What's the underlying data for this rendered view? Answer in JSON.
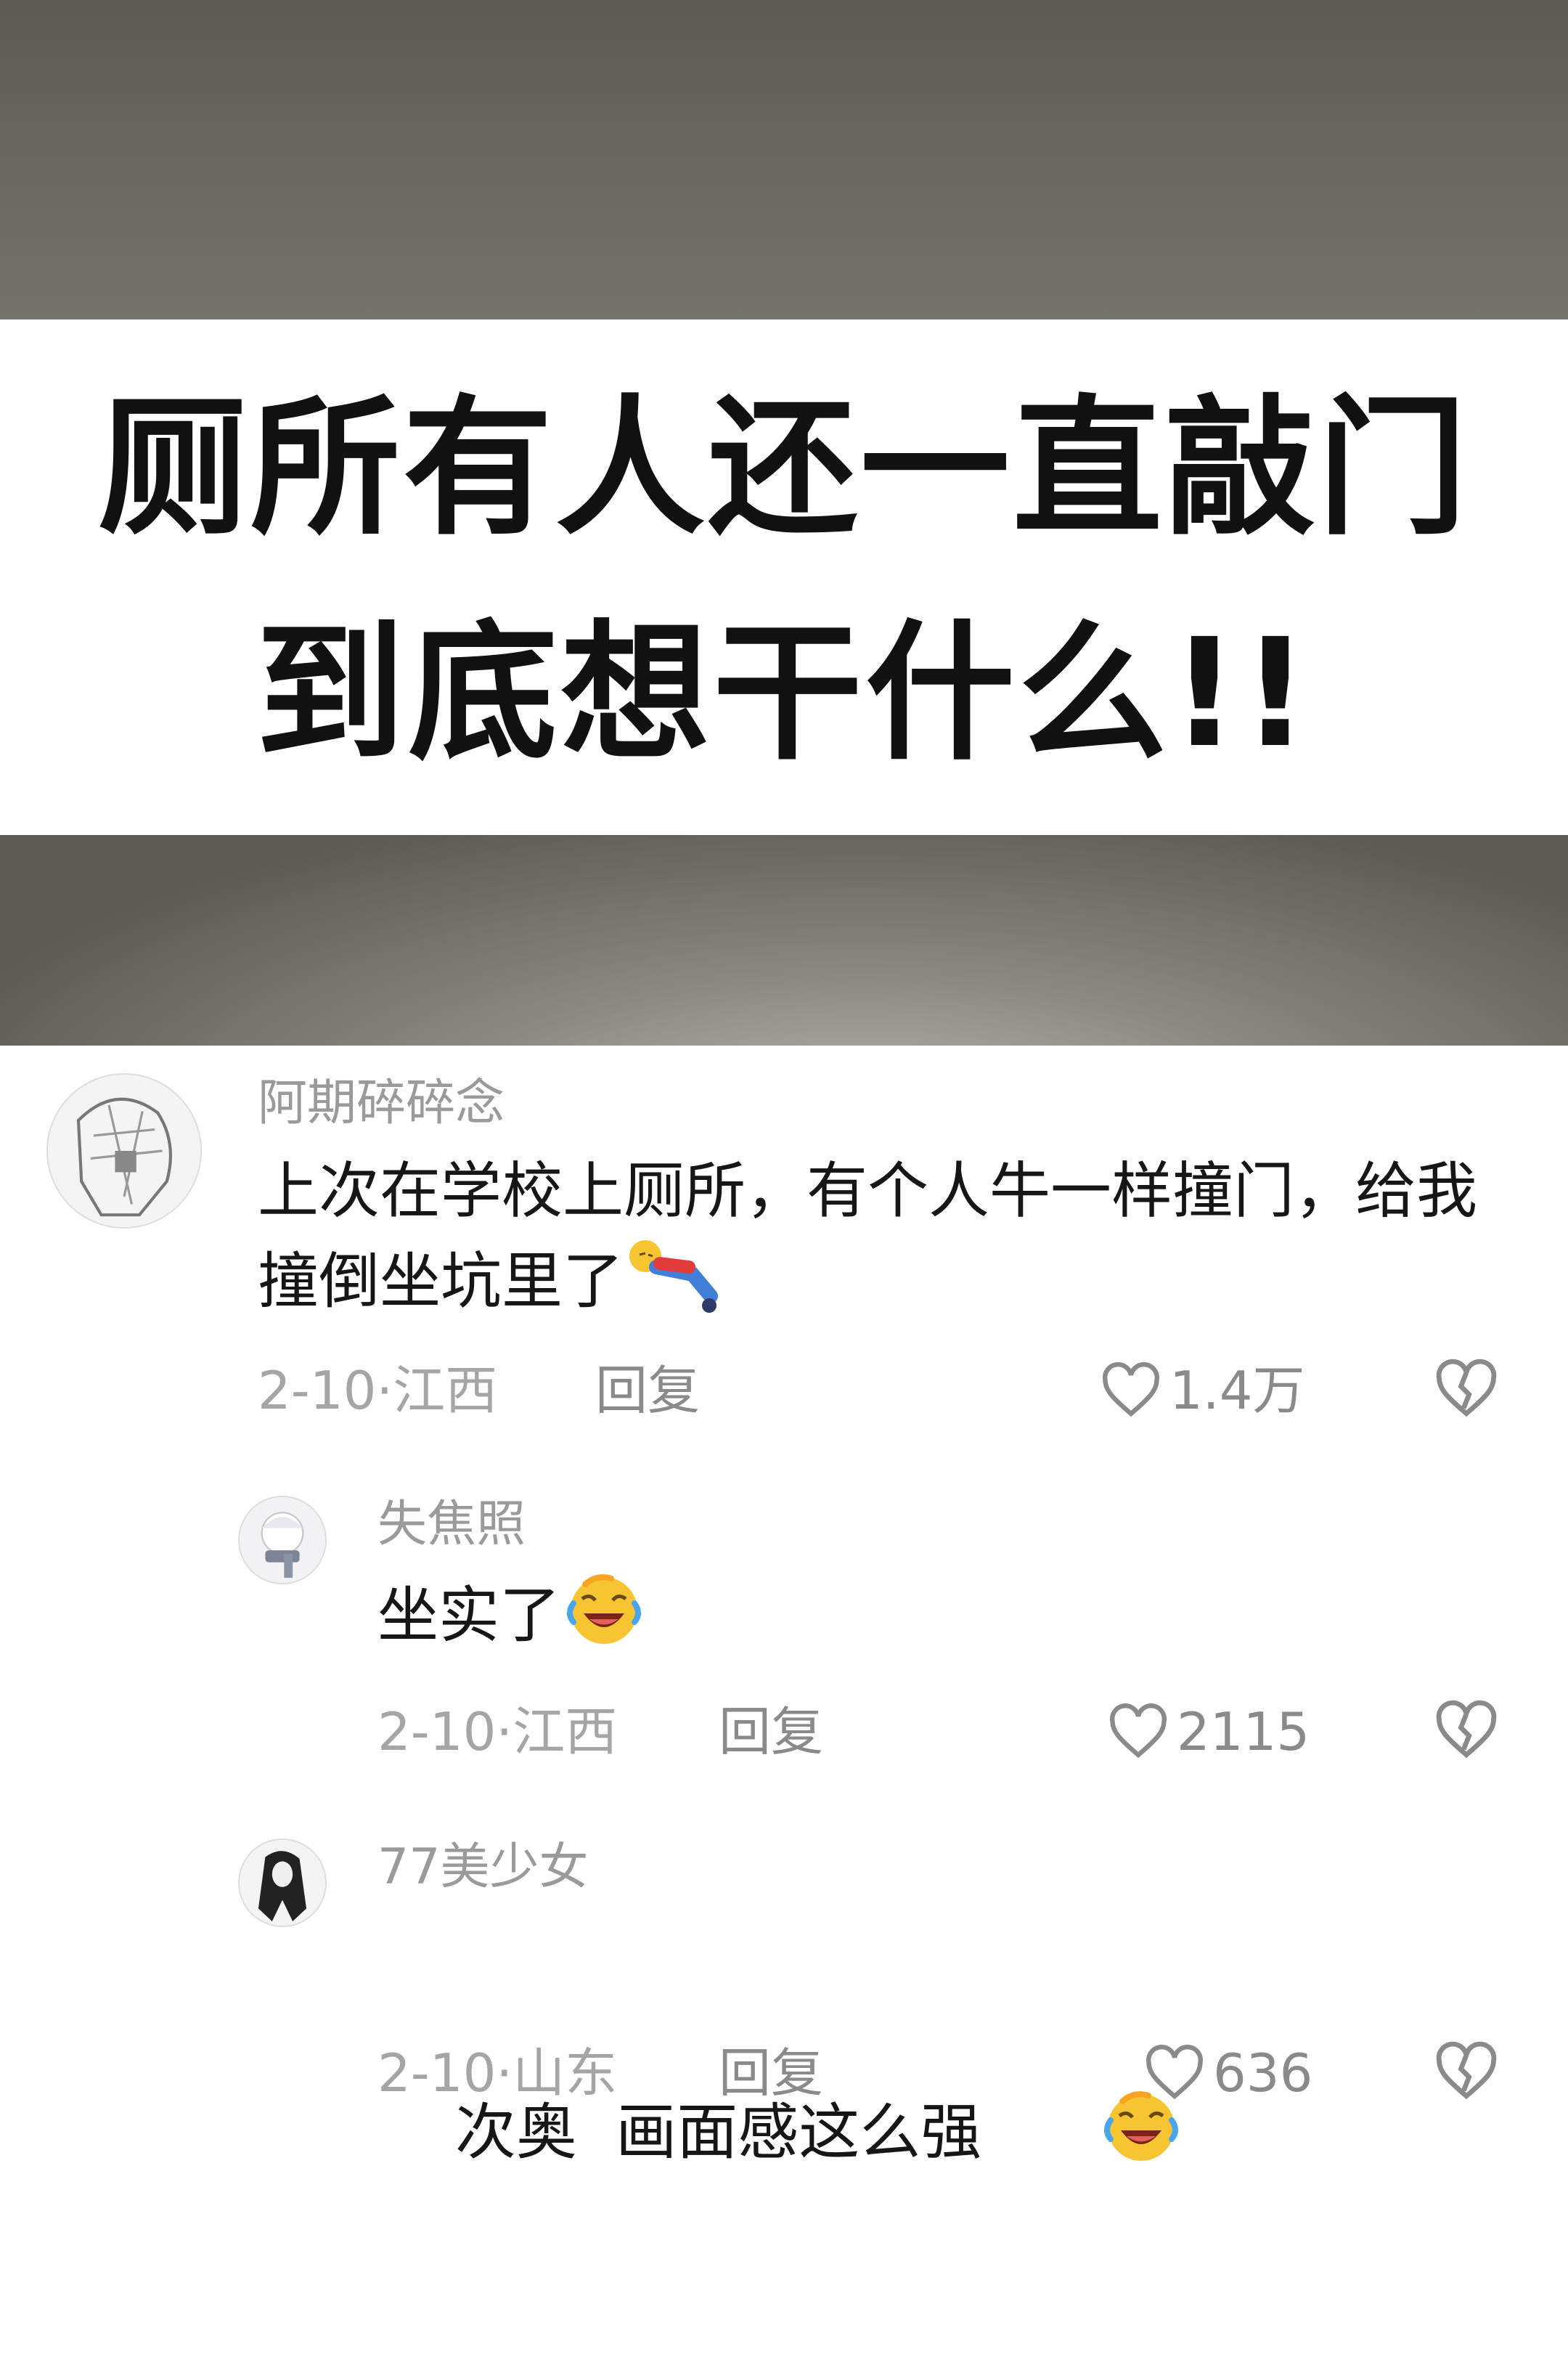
{
  "title": {
    "line1": "厕所有人还一直敲门",
    "line2": "到底想干什么!!"
  },
  "comments": [
    {
      "username": "阿期碎碎念",
      "text": "上次在学校上厕所，有个人牛一样撞门，给我撞倒坐坑里了",
      "emoji": "falling-person-emoji",
      "date_location": "2-10·江西",
      "reply_label": "回复",
      "likes": "1.4万"
    },
    {
      "username": "失焦照",
      "text": "坐实了",
      "emoji": "laughing-crying-emoji",
      "date_location": "2-10·江西",
      "reply_label": "回复",
      "likes": "2115"
    },
    {
      "username": "77美少女",
      "text": "次奥  画面感这么强",
      "emoji": "laughing-crying-emoji",
      "date_location": "2-10·山东",
      "reply_label": "回复",
      "likes": "636"
    }
  ],
  "colors": {
    "username": "#9a9a9a",
    "text": "#161616",
    "meta": "#a5a5a5",
    "icon": "#8a8a8a",
    "emoji_yellow": "#f7c531"
  }
}
